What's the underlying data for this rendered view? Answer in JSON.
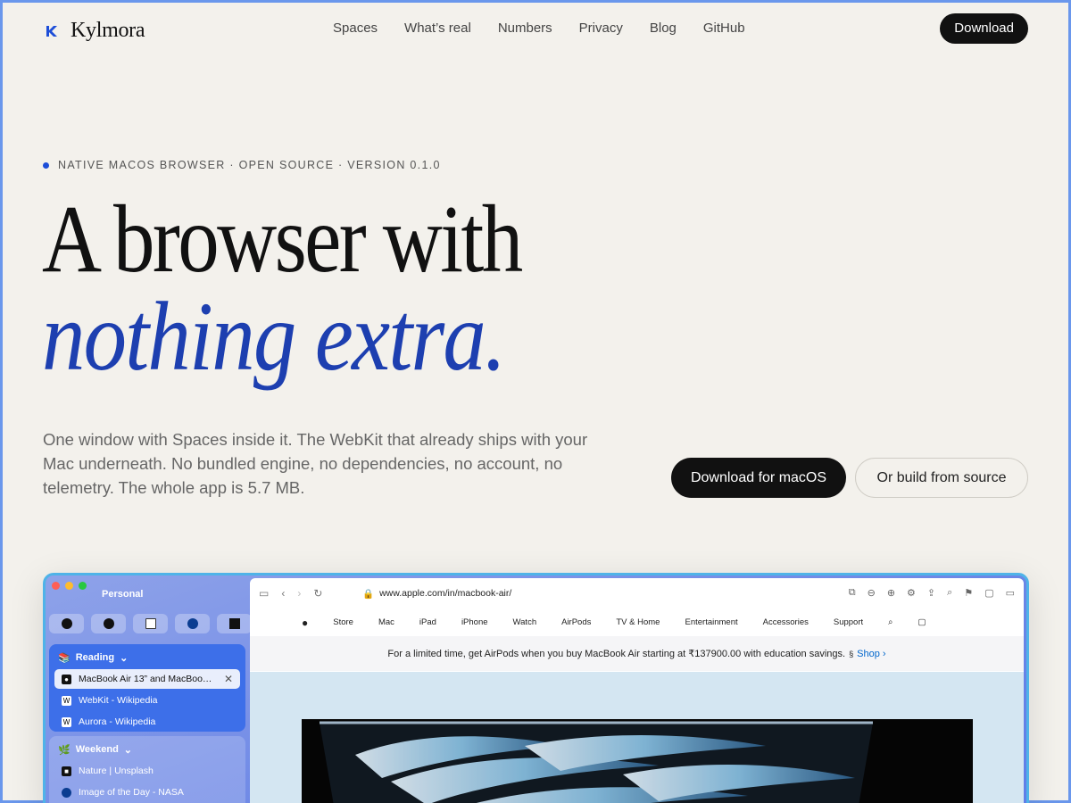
{
  "brand": {
    "name": "Kylmora",
    "accent": "#1d4ed8"
  },
  "nav": {
    "links": [
      "Spaces",
      "What’s real",
      "Numbers",
      "Privacy",
      "Blog",
      "GitHub"
    ],
    "download": "Download"
  },
  "hero": {
    "eyebrow": "NATIVE MACOS BROWSER · OPEN SOURCE · VERSION 0.1.0",
    "line1": "A browser with",
    "line2": "nothing extra.",
    "subtitle": "One window with Spaces inside it. The WebKit that already ships with your Mac underneath. No bundled engine, no dependencies, no account, no telemetry. The whole app is 5.7 MB.",
    "cta_primary": "Download for macOS",
    "cta_secondary": "Or build from source"
  },
  "browser": {
    "space": "Personal",
    "pinned_icons": [
      "apple-icon",
      "github-icon",
      "wikipedia-icon",
      "nasa-icon",
      "unsplash-icon"
    ],
    "groups": [
      {
        "name": "Reading",
        "tabs": [
          "MacBook Air 13” and MacBoo…",
          "WebKit - Wikipedia",
          "Aurora - Wikipedia"
        ]
      },
      {
        "name": "Weekend",
        "tabs": [
          "Nature | Unsplash",
          "Image of the Day - NASA"
        ]
      }
    ],
    "url": "www.apple.com/in/macbook-air/",
    "site_nav": [
      "Store",
      "Mac",
      "iPad",
      "iPhone",
      "Watch",
      "AirPods",
      "TV & Home",
      "Entertainment",
      "Accessories",
      "Support"
    ],
    "banner": "For a limited time, get AirPods when you buy MacBook Air starting at ₹137900.00 with education savings.",
    "banner_sup": "§",
    "banner_link": "Shop ›"
  }
}
